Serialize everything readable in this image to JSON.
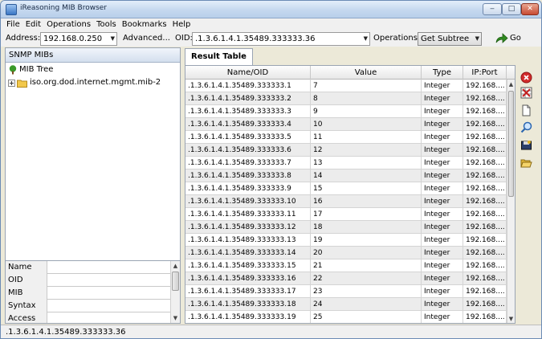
{
  "window": {
    "title": "iReasoning MIB Browser",
    "controls": {
      "minimize": "‒",
      "maximize": "□",
      "close": "✕"
    }
  },
  "menu": [
    "File",
    "Edit",
    "Operations",
    "Tools",
    "Bookmarks",
    "Help"
  ],
  "toolbar": {
    "address_label": "Address:",
    "address_value": "192.168.0.250",
    "advanced_label": "Advanced...",
    "oid_label": "OID:",
    "oid_value": ".1.3.6.1.4.1.35489.333333.36",
    "operations_label": "Operations:",
    "operations_value": "Get Subtree",
    "go_label": "Go"
  },
  "left": {
    "header": "SNMP MIBs",
    "tree": {
      "root": "MIB Tree",
      "child": "iso.org.dod.internet.mgmt.mib-2"
    },
    "properties": [
      {
        "key": "Name",
        "value": ""
      },
      {
        "key": "OID",
        "value": ""
      },
      {
        "key": "MIB",
        "value": ""
      },
      {
        "key": "Syntax",
        "value": ""
      },
      {
        "key": "Access",
        "value": ""
      }
    ]
  },
  "result": {
    "tab_label": "Result Table",
    "columns": [
      "Name/OID",
      "Value",
      "Type",
      "IP:Port"
    ],
    "rows": [
      {
        "oid": ".1.3.6.1.4.1.35489.333333.1",
        "value": "7",
        "type": "Integer",
        "ip": "192.168...."
      },
      {
        "oid": ".1.3.6.1.4.1.35489.333333.2",
        "value": "8",
        "type": "Integer",
        "ip": "192.168...."
      },
      {
        "oid": ".1.3.6.1.4.1.35489.333333.3",
        "value": "9",
        "type": "Integer",
        "ip": "192.168...."
      },
      {
        "oid": ".1.3.6.1.4.1.35489.333333.4",
        "value": "10",
        "type": "Integer",
        "ip": "192.168...."
      },
      {
        "oid": ".1.3.6.1.4.1.35489.333333.5",
        "value": "11",
        "type": "Integer",
        "ip": "192.168...."
      },
      {
        "oid": ".1.3.6.1.4.1.35489.333333.6",
        "value": "12",
        "type": "Integer",
        "ip": "192.168...."
      },
      {
        "oid": ".1.3.6.1.4.1.35489.333333.7",
        "value": "13",
        "type": "Integer",
        "ip": "192.168...."
      },
      {
        "oid": ".1.3.6.1.4.1.35489.333333.8",
        "value": "14",
        "type": "Integer",
        "ip": "192.168...."
      },
      {
        "oid": ".1.3.6.1.4.1.35489.333333.9",
        "value": "15",
        "type": "Integer",
        "ip": "192.168...."
      },
      {
        "oid": ".1.3.6.1.4.1.35489.333333.10",
        "value": "16",
        "type": "Integer",
        "ip": "192.168...."
      },
      {
        "oid": ".1.3.6.1.4.1.35489.333333.11",
        "value": "17",
        "type": "Integer",
        "ip": "192.168...."
      },
      {
        "oid": ".1.3.6.1.4.1.35489.333333.12",
        "value": "18",
        "type": "Integer",
        "ip": "192.168...."
      },
      {
        "oid": ".1.3.6.1.4.1.35489.333333.13",
        "value": "19",
        "type": "Integer",
        "ip": "192.168...."
      },
      {
        "oid": ".1.3.6.1.4.1.35489.333333.14",
        "value": "20",
        "type": "Integer",
        "ip": "192.168...."
      },
      {
        "oid": ".1.3.6.1.4.1.35489.333333.15",
        "value": "21",
        "type": "Integer",
        "ip": "192.168...."
      },
      {
        "oid": ".1.3.6.1.4.1.35489.333333.16",
        "value": "22",
        "type": "Integer",
        "ip": "192.168...."
      },
      {
        "oid": ".1.3.6.1.4.1.35489.333333.17",
        "value": "23",
        "type": "Integer",
        "ip": "192.168...."
      },
      {
        "oid": ".1.3.6.1.4.1.35489.333333.18",
        "value": "24",
        "type": "Integer",
        "ip": "192.168...."
      },
      {
        "oid": ".1.3.6.1.4.1.35489.333333.19",
        "value": "25",
        "type": "Integer",
        "ip": "192.168...."
      }
    ]
  },
  "side_icons": [
    "stop-icon",
    "delete-rows-icon",
    "export-icon",
    "find-icon",
    "save-icon",
    "open-icon"
  ],
  "status": ".1.3.6.1.4.1.35489.333333.36",
  "colors": {
    "title_bar": "#c5d8ef",
    "row_alt": "#ececec",
    "go_arrow": "#2f8a1f",
    "stop_red": "#d22b2b"
  }
}
